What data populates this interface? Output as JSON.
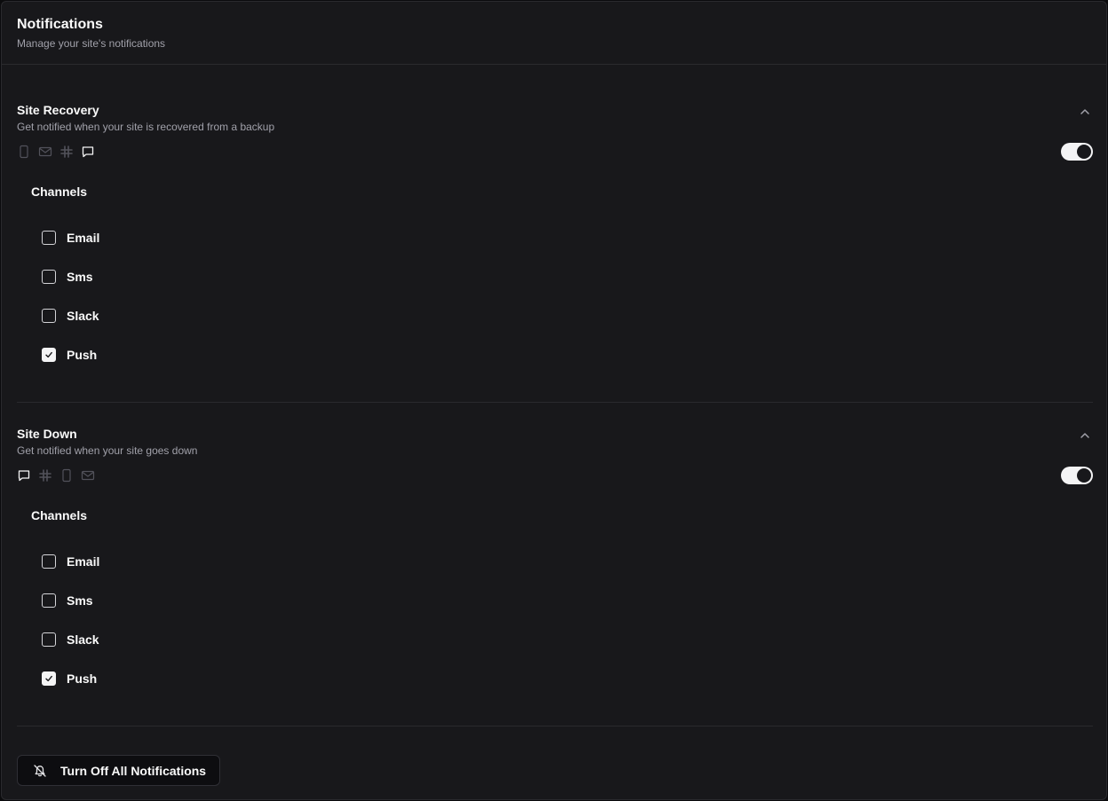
{
  "header": {
    "title": "Notifications",
    "description": "Manage your site's notifications"
  },
  "sections": [
    {
      "title": "Site Recovery",
      "description": "Get notified when your site is recovered from a backup",
      "icons": [
        {
          "name": "phone-icon",
          "active": false
        },
        {
          "name": "mail-icon",
          "active": false
        },
        {
          "name": "slack-icon",
          "active": false
        },
        {
          "name": "message-icon",
          "active": true
        }
      ],
      "enabled": true,
      "channels_title": "Channels",
      "channels": [
        {
          "label": "Email",
          "checked": false
        },
        {
          "label": "Sms",
          "checked": false
        },
        {
          "label": "Slack",
          "checked": false
        },
        {
          "label": "Push",
          "checked": true
        }
      ]
    },
    {
      "title": "Site Down",
      "description": "Get notified when your site goes down",
      "icons": [
        {
          "name": "message-icon",
          "active": true
        },
        {
          "name": "slack-icon",
          "active": false
        },
        {
          "name": "phone-icon",
          "active": false
        },
        {
          "name": "mail-icon",
          "active": false
        }
      ],
      "enabled": true,
      "channels_title": "Channels",
      "channels": [
        {
          "label": "Email",
          "checked": false
        },
        {
          "label": "Sms",
          "checked": false
        },
        {
          "label": "Slack",
          "checked": false
        },
        {
          "label": "Push",
          "checked": true
        }
      ]
    }
  ],
  "footer": {
    "button_label": "Turn Off All Notifications"
  },
  "colors": {
    "background": "#18181b",
    "text": "#fafafa",
    "muted": "#a1a1aa",
    "icon_inactive": "#52525b",
    "icon_active": "#f4f4f5"
  }
}
